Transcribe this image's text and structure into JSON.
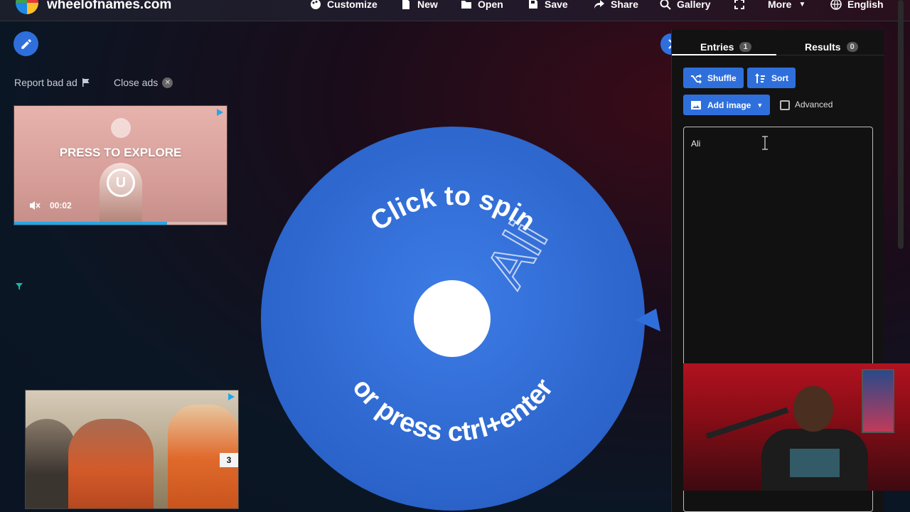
{
  "nav": {
    "site_name": "wheelofnames.com",
    "items": [
      {
        "label": "Customize",
        "icon": "palette-icon"
      },
      {
        "label": "New",
        "icon": "file-icon"
      },
      {
        "label": "Open",
        "icon": "folder-icon"
      },
      {
        "label": "Save",
        "icon": "save-icon"
      },
      {
        "label": "Share",
        "icon": "share-icon"
      },
      {
        "label": "Gallery",
        "icon": "search-icon"
      },
      {
        "label": "",
        "icon": "fullscreen-icon"
      },
      {
        "label": "More",
        "icon": "chevron-down-icon"
      },
      {
        "label": "English",
        "icon": "globe-icon"
      }
    ]
  },
  "ads": {
    "report_label": "Report bad ad",
    "close_label": "Close ads",
    "ad1": {
      "headline": "PRESS TO EXPLORE",
      "time": "00:02",
      "progress": 0.72
    },
    "ad2": {
      "counter": "3"
    }
  },
  "wheel": {
    "color": "#2f6fdc",
    "top_text": "Click to spin",
    "bottom_text": "or press ctrl+enter",
    "entry_label": "Ali"
  },
  "panel": {
    "tabs": [
      {
        "label": "Entries",
        "count": "1"
      },
      {
        "label": "Results",
        "count": "0"
      }
    ],
    "shuffle_label": "Shuffle",
    "sort_label": "Sort",
    "add_image_label": "Add image",
    "advanced_label": "Advanced",
    "entries_text": "Ali"
  },
  "colors": {
    "accent": "#2f6fdc",
    "panel_bg": "#121212"
  }
}
